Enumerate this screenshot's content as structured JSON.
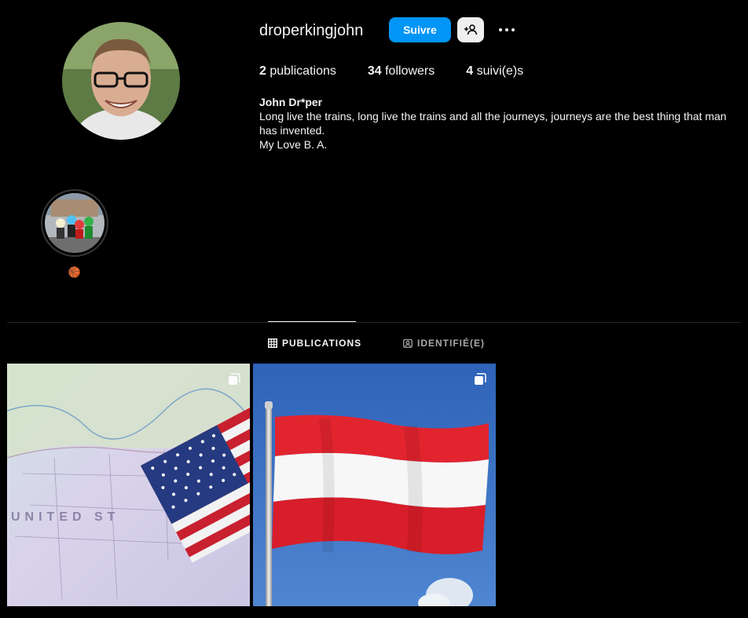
{
  "profile": {
    "username": "droperkingjohn",
    "follow_label": "Suivre",
    "display_name": "John Dr*per",
    "bio_line1": "Long live the trains, long live the trains and all the journeys, journeys are the best thing that man has invented.",
    "bio_line2": "My Love B. A."
  },
  "stats": {
    "posts_count": "2",
    "posts_label": "publications",
    "followers_count": "34",
    "followers_label": "followers",
    "following_count": "4",
    "following_label": "suivi(e)s"
  },
  "highlights": [
    {
      "label": "🏀"
    }
  ],
  "tabs": {
    "publications": "PUBLICATIONS",
    "tagged": "IDENTIFIÉ(E)"
  },
  "icons": {
    "add_user": "add-user-icon",
    "more": "more-icon",
    "grid": "grid-icon",
    "tagged": "tagged-icon",
    "carousel": "carousel-icon"
  },
  "colors": {
    "accent": "#0095f6",
    "background": "#000000",
    "text": "#f5f5f5",
    "muted": "#a8a8a8"
  }
}
